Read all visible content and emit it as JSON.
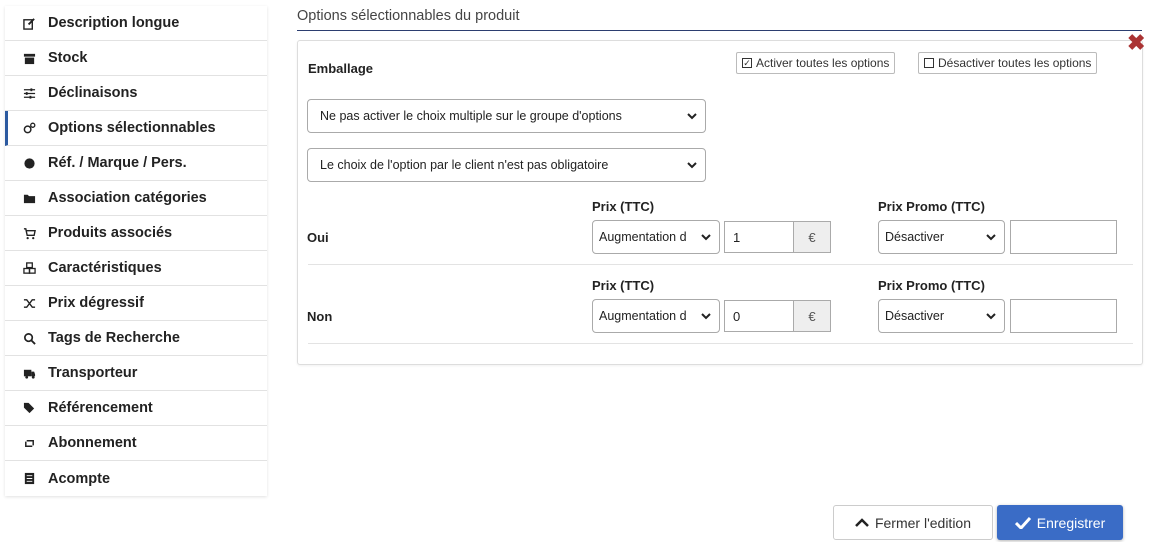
{
  "sidebar": {
    "items": [
      {
        "label": "Description longue",
        "icon": "edit-icon"
      },
      {
        "label": "Stock",
        "icon": "archive-icon"
      },
      {
        "label": "Déclinaisons",
        "icon": "sliders-icon"
      },
      {
        "label": "Options sélectionnables",
        "icon": "cogs-icon",
        "active": true
      },
      {
        "label": "Réf. / Marque / Pers.",
        "icon": "certificate-icon"
      },
      {
        "label": "Association catégories",
        "icon": "folder-icon"
      },
      {
        "label": "Produits associés",
        "icon": "cart-icon"
      },
      {
        "label": "Caractéristiques",
        "icon": "cubes-icon"
      },
      {
        "label": "Prix dégressif",
        "icon": "random-icon"
      },
      {
        "label": "Tags de Recherche",
        "icon": "search-icon"
      },
      {
        "label": "Transporteur",
        "icon": "truck-icon"
      },
      {
        "label": "Référencement",
        "icon": "tags-icon"
      },
      {
        "label": "Abonnement",
        "icon": "retweet-icon"
      },
      {
        "label": "Acompte",
        "icon": "list-icon"
      }
    ]
  },
  "main": {
    "title": "Options sélectionnables du produit",
    "group": {
      "label": "Emballage",
      "activate_all": "Activer toutes les options",
      "deactivate_all": "Désactiver toutes les options",
      "multiple_choice_select": "Ne pas activer le choix multiple sur le groupe d'options",
      "mandatory_select": "Le choix de l'option par le client n'est pas obligatoire",
      "price_header": "Prix (TTC)",
      "promo_header": "Prix Promo (TTC)",
      "rows": [
        {
          "label": "Oui",
          "price_mode": "Augmentation d",
          "price_value": "1",
          "currency": "€",
          "promo_mode": "Désactiver",
          "promo_value": ""
        },
        {
          "label": "Non",
          "price_mode": "Augmentation d",
          "price_value": "0",
          "currency": "€",
          "promo_mode": "Désactiver",
          "promo_value": ""
        }
      ]
    }
  },
  "footer": {
    "close_edit": "Fermer l'edition",
    "save": "Enregistrer"
  },
  "colors": {
    "accent": "#3a6cc6",
    "active_border": "#2c5aa0",
    "close_x": "#a33333"
  }
}
